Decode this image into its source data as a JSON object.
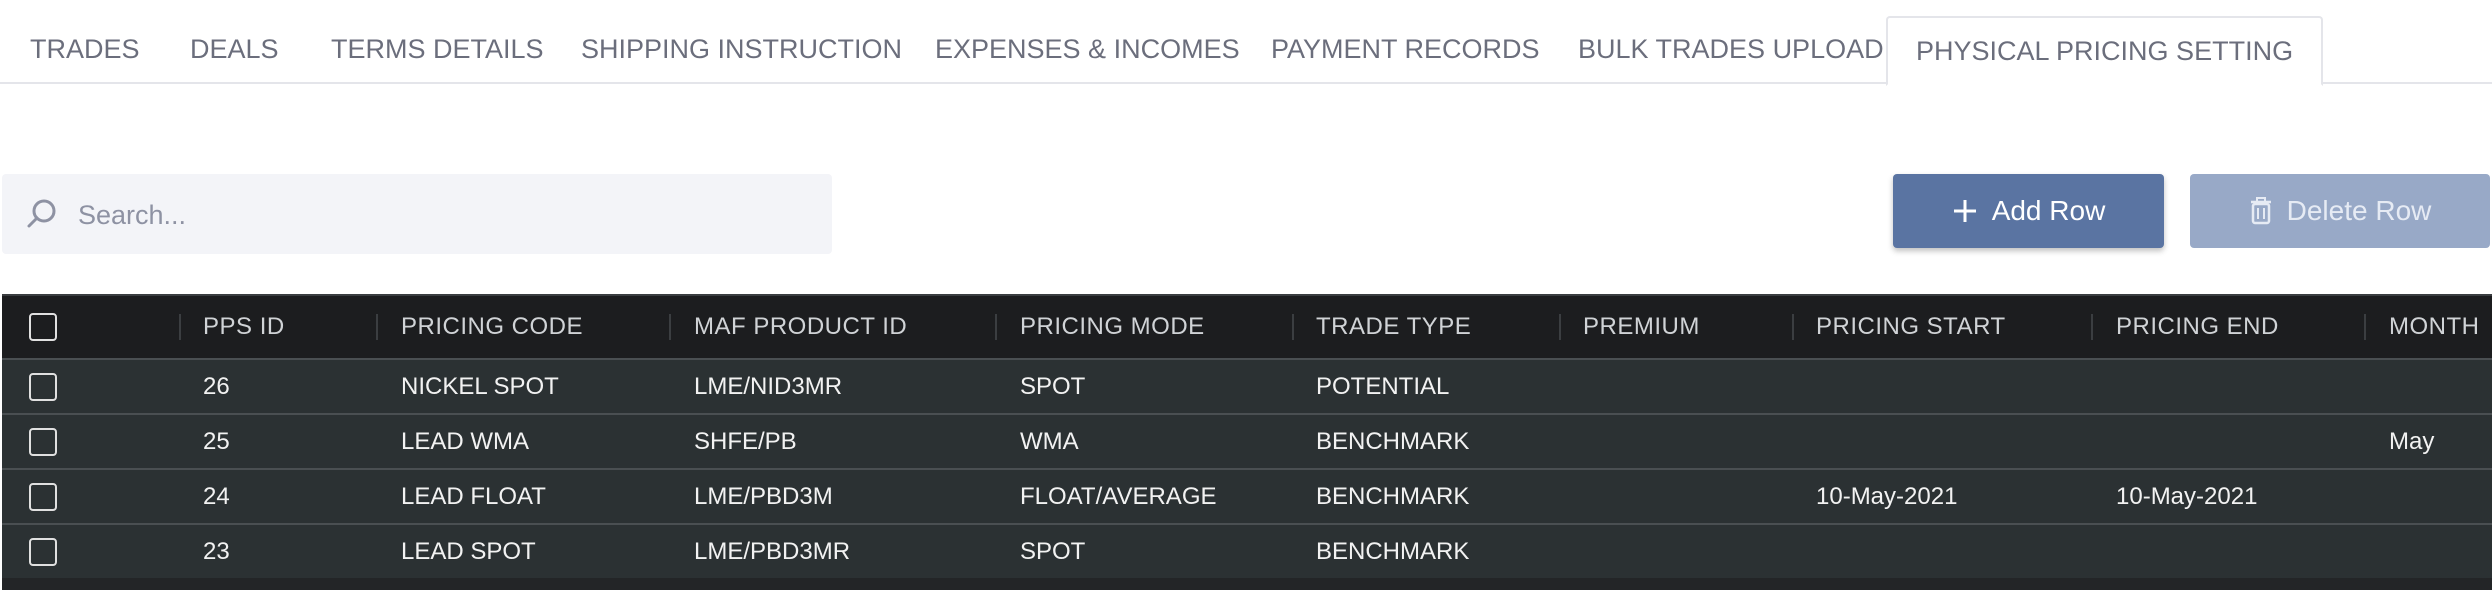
{
  "tabs": [
    {
      "label": "TRADES"
    },
    {
      "label": "DEALS"
    },
    {
      "label": "TERMS DETAILS"
    },
    {
      "label": "SHIPPING INSTRUCTION"
    },
    {
      "label": "EXPENSES & INCOMES"
    },
    {
      "label": "PAYMENT RECORDS"
    },
    {
      "label": "BULK TRADES UPLOAD"
    },
    {
      "label": "PHYSICAL PRICING SETTING",
      "active": true
    }
  ],
  "search": {
    "placeholder": "Search...",
    "value": ""
  },
  "toolbar": {
    "add_label": "Add Row",
    "delete_label": "Delete Row"
  },
  "table": {
    "headers": [
      "PPS ID",
      "PRICING CODE",
      "MAF PRODUCT ID",
      "PRICING MODE",
      "TRADE TYPE",
      "PREMIUM",
      "PRICING START",
      "PRICING END",
      "MONTH"
    ],
    "rows": [
      [
        "26",
        "NICKEL SPOT",
        "LME/NID3MR",
        "SPOT",
        "POTENTIAL",
        "",
        "",
        "",
        ""
      ],
      [
        "25",
        "LEAD WMA",
        "SHFE/PB",
        "WMA",
        "BENCHMARK",
        "",
        "",
        "",
        "May"
      ],
      [
        "24",
        "LEAD FLOAT",
        "LME/PBD3M",
        "FLOAT/AVERAGE",
        "BENCHMARK",
        "",
        "10-May-2021",
        "10-May-2021",
        ""
      ],
      [
        "23",
        "LEAD SPOT",
        "LME/PBD3MR",
        "SPOT",
        "BENCHMARK",
        "",
        "",
        "",
        ""
      ]
    ]
  },
  "colors": {
    "accent": "#5a74a2",
    "accent_disabled": "#98a9c7",
    "grid_bg": "#2b3133",
    "header_bg": "#1c1d1f"
  },
  "icons": {
    "search": "search-icon",
    "add": "plus-icon",
    "delete": "trash-icon"
  }
}
